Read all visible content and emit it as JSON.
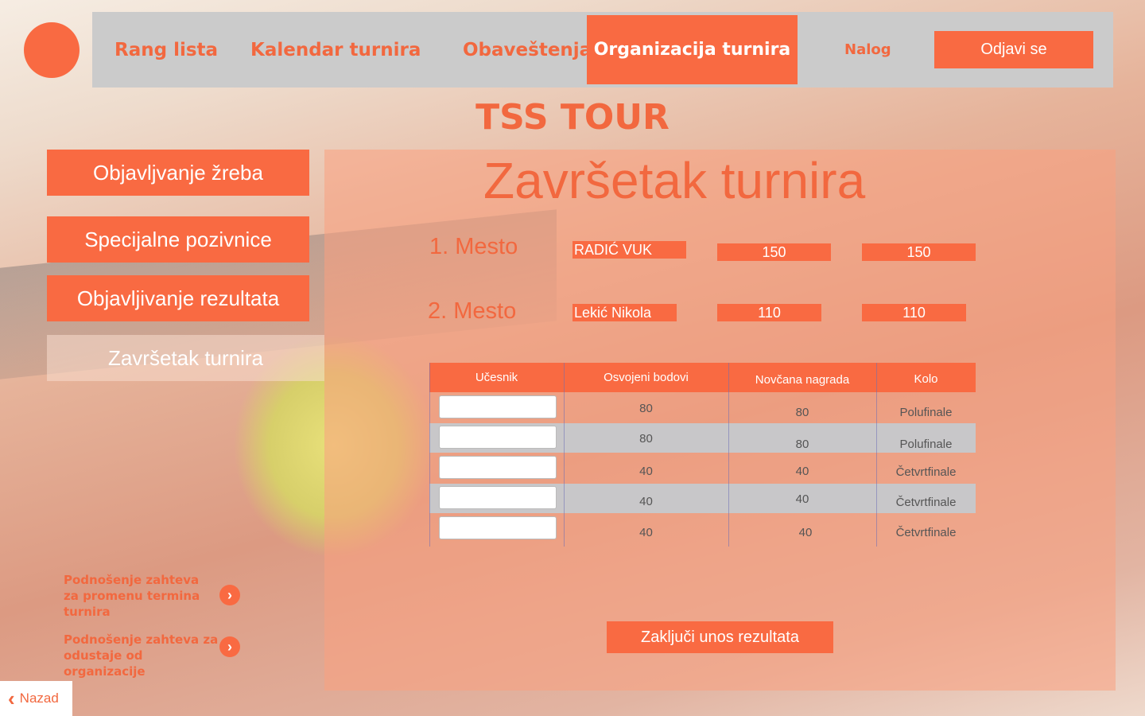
{
  "nav": {
    "items": [
      "Rang lista",
      "Kalendar turnira",
      "Obaveštenja"
    ],
    "active": "Organizacija turnira",
    "account": "Nalog",
    "logout": "Odjavi se"
  },
  "site_title": "TSS TOUR",
  "sidebar": {
    "items": [
      "Objavljvanje žreba",
      "Specijalne pozivnice",
      "Objavljivanje rezultata"
    ],
    "active": "Završetak turnira"
  },
  "panel": {
    "title": "Završetak turnira",
    "places": [
      {
        "label": "1. Mesto",
        "player": "RADIĆ VUK",
        "points": "150",
        "prize": "150"
      },
      {
        "label": "2. Mesto",
        "player": "Lekić Nikola",
        "points": "110",
        "prize": "110"
      }
    ],
    "table": {
      "headers": [
        "Učesnik",
        "Osvojeni bodovi",
        "Novčana nagrada",
        "Kolo"
      ],
      "rows": [
        {
          "participant": "",
          "points": "80",
          "prize": "80",
          "round": "Polufinale"
        },
        {
          "participant": "",
          "points": "80",
          "prize": "80",
          "round": "Polufinale"
        },
        {
          "participant": "",
          "points": "40",
          "prize": "40",
          "round": "Četvrtfinale"
        },
        {
          "participant": "",
          "points": "40",
          "prize": "40",
          "round": "Četvrtfinale"
        },
        {
          "participant": "",
          "points": "40",
          "prize": "40",
          "round": "Četvrtfinale"
        }
      ]
    },
    "confirm": "Zaključi unos rezultata"
  },
  "requests": [
    "Podnošenje zahteva za promenu termina turnira",
    "Podnošenje zahteva za odustaje od organizacije"
  ],
  "back": "Nazad",
  "colors": {
    "accent": "#f96a42",
    "nav_bg": "#cbcbcb"
  }
}
